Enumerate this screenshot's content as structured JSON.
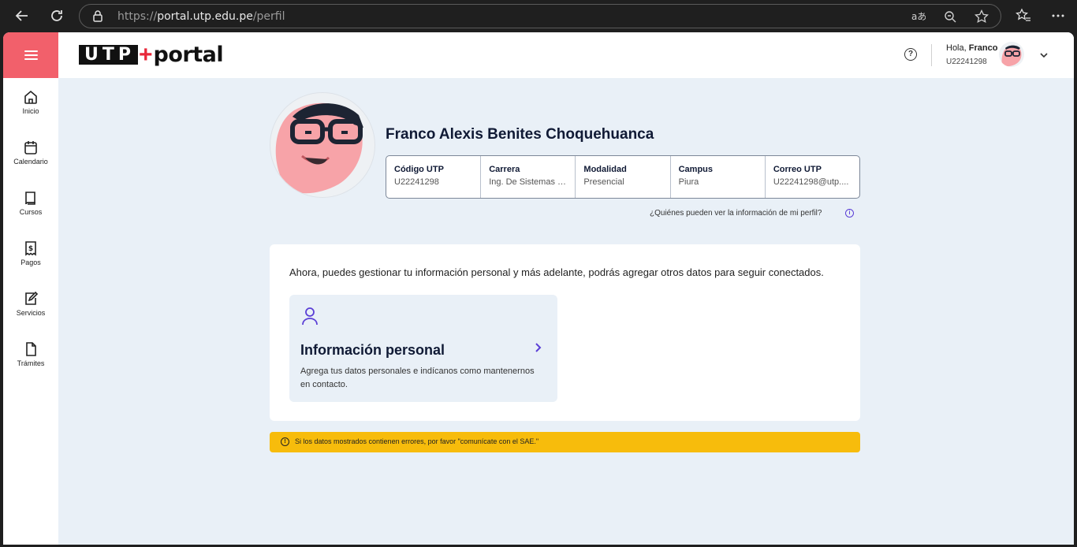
{
  "browser": {
    "url_scheme": "https://",
    "url_host": "portal.utp.edu.pe",
    "url_path": "/perfil"
  },
  "header": {
    "logo_utp": "UTP",
    "logo_plus": "+",
    "logo_portal": "portal",
    "help_symbol": "?",
    "greeting_prefix": "Hola, ",
    "greeting_name": "Franco",
    "user_code": "U22241298"
  },
  "sidebar": {
    "items": [
      {
        "label": "Inicio",
        "icon": "home-icon"
      },
      {
        "label": "Calendario",
        "icon": "calendar-icon"
      },
      {
        "label": "Cursos",
        "icon": "book-icon"
      },
      {
        "label": "Pagos",
        "icon": "receipt-icon"
      },
      {
        "label": "Servicios",
        "icon": "edit-icon"
      },
      {
        "label": "Trámites",
        "icon": "document-icon"
      }
    ]
  },
  "profile": {
    "full_name": "Franco Alexis Benites Choquehuanca",
    "fields": [
      {
        "label": "Código UTP",
        "value": "U22241298"
      },
      {
        "label": "Carrera",
        "value": "Ing. De Sistemas E ..."
      },
      {
        "label": "Modalidad",
        "value": "Presencial"
      },
      {
        "label": "Campus",
        "value": "Piura"
      },
      {
        "label": "Correo UTP",
        "value": "U22241298@utp...."
      }
    ],
    "visibility_link": "¿Quiénes pueden ver la información de mi perfil?",
    "info_symbol": "i"
  },
  "main": {
    "intro": "Ahora, puedes gestionar tu información personal y más adelante, podrás agregar otros datos para seguir conectados.",
    "personal_card": {
      "title": "Información personal",
      "description": "Agrega tus datos personales e indícanos como mantenernos en contacto."
    }
  },
  "warning": {
    "symbol": "!",
    "text": "Si los datos mostrados contienen errores, por favor \"comunícate con el SAE.\""
  },
  "colors": {
    "accent_menu": "#f2606b",
    "brand_red": "#e8283a",
    "warning": "#f7bc0c",
    "link_purple": "#5b3fd6"
  }
}
